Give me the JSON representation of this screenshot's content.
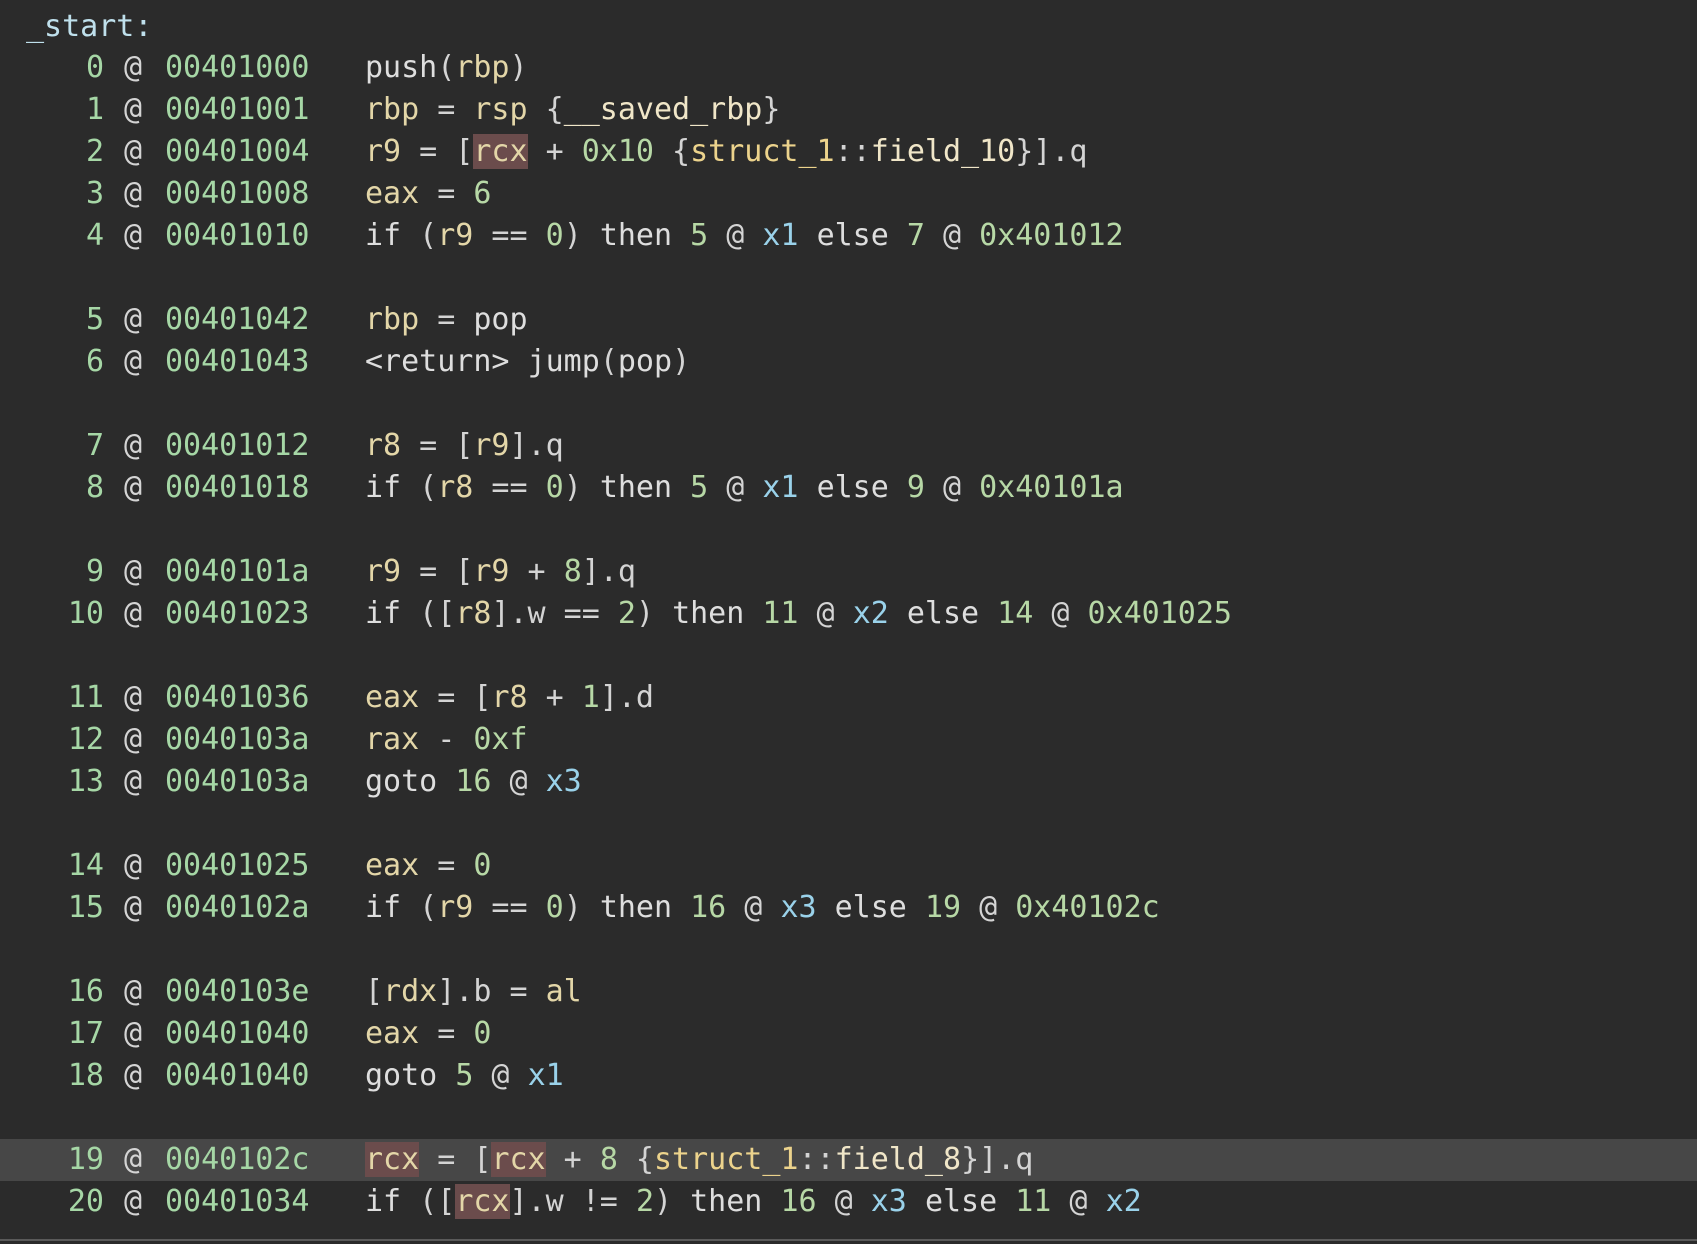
{
  "function_label": "_start:",
  "lines": [
    {
      "index": "0",
      "addr": "00401000",
      "tokens": [
        {
          "t": "push",
          "c": "kw"
        },
        {
          "t": "(",
          "c": "op"
        },
        {
          "t": "rbp",
          "c": "reg"
        },
        {
          "t": ")",
          "c": "op"
        }
      ]
    },
    {
      "index": "1",
      "addr": "00401001",
      "tokens": [
        {
          "t": "rbp",
          "c": "reg"
        },
        {
          "t": " = ",
          "c": "op"
        },
        {
          "t": "rsp",
          "c": "reg"
        },
        {
          "t": " {",
          "c": "op"
        },
        {
          "t": "__saved_rbp",
          "c": "field"
        },
        {
          "t": "}",
          "c": "op"
        }
      ]
    },
    {
      "index": "2",
      "addr": "00401004",
      "tokens": [
        {
          "t": "r9",
          "c": "reg"
        },
        {
          "t": " = [",
          "c": "op"
        },
        {
          "t": "rcx",
          "c": "reg",
          "hl": true
        },
        {
          "t": " + ",
          "c": "op"
        },
        {
          "t": "0x10",
          "c": "num"
        },
        {
          "t": " {",
          "c": "op"
        },
        {
          "t": "struct_1",
          "c": "type"
        },
        {
          "t": "::",
          "c": "op"
        },
        {
          "t": "field_10",
          "c": "field"
        },
        {
          "t": "}].q",
          "c": "op"
        }
      ]
    },
    {
      "index": "3",
      "addr": "00401008",
      "tokens": [
        {
          "t": "eax",
          "c": "reg"
        },
        {
          "t": " = ",
          "c": "op"
        },
        {
          "t": "6",
          "c": "num"
        }
      ]
    },
    {
      "index": "4",
      "addr": "00401010",
      "tokens": [
        {
          "t": "if",
          "c": "kw"
        },
        {
          "t": " (",
          "c": "op"
        },
        {
          "t": "r9",
          "c": "reg"
        },
        {
          "t": " == ",
          "c": "op"
        },
        {
          "t": "0",
          "c": "num"
        },
        {
          "t": ") ",
          "c": "op"
        },
        {
          "t": "then",
          "c": "kw"
        },
        {
          "t": " ",
          "c": "op"
        },
        {
          "t": "5",
          "c": "num"
        },
        {
          "t": " @ ",
          "c": "op"
        },
        {
          "t": "x1",
          "c": "lbl"
        },
        {
          "t": " ",
          "c": "op"
        },
        {
          "t": "else",
          "c": "kw"
        },
        {
          "t": " ",
          "c": "op"
        },
        {
          "t": "7",
          "c": "num"
        },
        {
          "t": " @ ",
          "c": "op"
        },
        {
          "t": "0x401012",
          "c": "num"
        }
      ]
    },
    {
      "index": "5",
      "addr": "00401042",
      "tokens": [
        {
          "t": "rbp",
          "c": "reg"
        },
        {
          "t": " = ",
          "c": "op"
        },
        {
          "t": "pop",
          "c": "kw"
        }
      ]
    },
    {
      "index": "6",
      "addr": "00401043",
      "tokens": [
        {
          "t": "<return>",
          "c": "kw"
        },
        {
          "t": " ",
          "c": "op"
        },
        {
          "t": "jump",
          "c": "kw"
        },
        {
          "t": "(",
          "c": "op"
        },
        {
          "t": "pop",
          "c": "kw"
        },
        {
          "t": ")",
          "c": "op"
        }
      ]
    },
    {
      "index": "7",
      "addr": "00401012",
      "tokens": [
        {
          "t": "r8",
          "c": "reg"
        },
        {
          "t": " = [",
          "c": "op"
        },
        {
          "t": "r9",
          "c": "reg"
        },
        {
          "t": "].q",
          "c": "op"
        }
      ]
    },
    {
      "index": "8",
      "addr": "00401018",
      "tokens": [
        {
          "t": "if",
          "c": "kw"
        },
        {
          "t": " (",
          "c": "op"
        },
        {
          "t": "r8",
          "c": "reg"
        },
        {
          "t": " == ",
          "c": "op"
        },
        {
          "t": "0",
          "c": "num"
        },
        {
          "t": ") ",
          "c": "op"
        },
        {
          "t": "then",
          "c": "kw"
        },
        {
          "t": " ",
          "c": "op"
        },
        {
          "t": "5",
          "c": "num"
        },
        {
          "t": " @ ",
          "c": "op"
        },
        {
          "t": "x1",
          "c": "lbl"
        },
        {
          "t": " ",
          "c": "op"
        },
        {
          "t": "else",
          "c": "kw"
        },
        {
          "t": " ",
          "c": "op"
        },
        {
          "t": "9",
          "c": "num"
        },
        {
          "t": " @ ",
          "c": "op"
        },
        {
          "t": "0x40101a",
          "c": "num"
        }
      ]
    },
    {
      "index": "9",
      "addr": "0040101a",
      "tokens": [
        {
          "t": "r9",
          "c": "reg"
        },
        {
          "t": " = [",
          "c": "op"
        },
        {
          "t": "r9",
          "c": "reg"
        },
        {
          "t": " + ",
          "c": "op"
        },
        {
          "t": "8",
          "c": "num"
        },
        {
          "t": "].q",
          "c": "op"
        }
      ]
    },
    {
      "index": "10",
      "addr": "00401023",
      "tokens": [
        {
          "t": "if",
          "c": "kw"
        },
        {
          "t": " ([",
          "c": "op"
        },
        {
          "t": "r8",
          "c": "reg"
        },
        {
          "t": "].w == ",
          "c": "op"
        },
        {
          "t": "2",
          "c": "num"
        },
        {
          "t": ") ",
          "c": "op"
        },
        {
          "t": "then",
          "c": "kw"
        },
        {
          "t": " ",
          "c": "op"
        },
        {
          "t": "11",
          "c": "num"
        },
        {
          "t": " @ ",
          "c": "op"
        },
        {
          "t": "x2",
          "c": "lbl"
        },
        {
          "t": " ",
          "c": "op"
        },
        {
          "t": "else",
          "c": "kw"
        },
        {
          "t": " ",
          "c": "op"
        },
        {
          "t": "14",
          "c": "num"
        },
        {
          "t": " @ ",
          "c": "op"
        },
        {
          "t": "0x401025",
          "c": "num"
        }
      ]
    },
    {
      "index": "11",
      "addr": "00401036",
      "tokens": [
        {
          "t": "eax",
          "c": "reg"
        },
        {
          "t": " = [",
          "c": "op"
        },
        {
          "t": "r8",
          "c": "reg"
        },
        {
          "t": " + ",
          "c": "op"
        },
        {
          "t": "1",
          "c": "num"
        },
        {
          "t": "].d",
          "c": "op"
        }
      ]
    },
    {
      "index": "12",
      "addr": "0040103a",
      "tokens": [
        {
          "t": "rax",
          "c": "reg"
        },
        {
          "t": " - ",
          "c": "op"
        },
        {
          "t": "0xf",
          "c": "num"
        }
      ]
    },
    {
      "index": "13",
      "addr": "0040103a",
      "tokens": [
        {
          "t": "goto",
          "c": "kw"
        },
        {
          "t": " ",
          "c": "op"
        },
        {
          "t": "16",
          "c": "num"
        },
        {
          "t": " @ ",
          "c": "op"
        },
        {
          "t": "x3",
          "c": "lbl"
        }
      ]
    },
    {
      "index": "14",
      "addr": "00401025",
      "tokens": [
        {
          "t": "eax",
          "c": "reg"
        },
        {
          "t": " = ",
          "c": "op"
        },
        {
          "t": "0",
          "c": "num"
        }
      ]
    },
    {
      "index": "15",
      "addr": "0040102a",
      "tokens": [
        {
          "t": "if",
          "c": "kw"
        },
        {
          "t": " (",
          "c": "op"
        },
        {
          "t": "r9",
          "c": "reg"
        },
        {
          "t": " == ",
          "c": "op"
        },
        {
          "t": "0",
          "c": "num"
        },
        {
          "t": ") ",
          "c": "op"
        },
        {
          "t": "then",
          "c": "kw"
        },
        {
          "t": " ",
          "c": "op"
        },
        {
          "t": "16",
          "c": "num"
        },
        {
          "t": " @ ",
          "c": "op"
        },
        {
          "t": "x3",
          "c": "lbl"
        },
        {
          "t": " ",
          "c": "op"
        },
        {
          "t": "else",
          "c": "kw"
        },
        {
          "t": " ",
          "c": "op"
        },
        {
          "t": "19",
          "c": "num"
        },
        {
          "t": " @ ",
          "c": "op"
        },
        {
          "t": "0x40102c",
          "c": "num"
        }
      ]
    },
    {
      "index": "16",
      "addr": "0040103e",
      "tokens": [
        {
          "t": "[",
          "c": "op"
        },
        {
          "t": "rdx",
          "c": "reg"
        },
        {
          "t": "].b = ",
          "c": "op"
        },
        {
          "t": "al",
          "c": "reg"
        }
      ]
    },
    {
      "index": "17",
      "addr": "00401040",
      "tokens": [
        {
          "t": "eax",
          "c": "reg"
        },
        {
          "t": " = ",
          "c": "op"
        },
        {
          "t": "0",
          "c": "num"
        }
      ]
    },
    {
      "index": "18",
      "addr": "00401040",
      "tokens": [
        {
          "t": "goto",
          "c": "kw"
        },
        {
          "t": " ",
          "c": "op"
        },
        {
          "t": "5",
          "c": "num"
        },
        {
          "t": " @ ",
          "c": "op"
        },
        {
          "t": "x1",
          "c": "lbl"
        }
      ]
    },
    {
      "index": "19",
      "addr": "0040102c",
      "selected": true,
      "tokens": [
        {
          "t": "rcx",
          "c": "reg",
          "hl": true
        },
        {
          "t": " = [",
          "c": "op"
        },
        {
          "t": "rcx",
          "c": "reg",
          "hl": true
        },
        {
          "t": " + ",
          "c": "op"
        },
        {
          "t": "8",
          "c": "num"
        },
        {
          "t": " {",
          "c": "op"
        },
        {
          "t": "struct_1",
          "c": "type"
        },
        {
          "t": "::",
          "c": "op"
        },
        {
          "t": "field_8",
          "c": "field"
        },
        {
          "t": "}].q",
          "c": "op"
        }
      ]
    },
    {
      "index": "20",
      "addr": "00401034",
      "tokens": [
        {
          "t": "if",
          "c": "kw"
        },
        {
          "t": " ([",
          "c": "op"
        },
        {
          "t": "rcx",
          "c": "reg",
          "hl": true
        },
        {
          "t": "].w != ",
          "c": "op"
        },
        {
          "t": "2",
          "c": "num"
        },
        {
          "t": ") ",
          "c": "op"
        },
        {
          "t": "then",
          "c": "kw"
        },
        {
          "t": " ",
          "c": "op"
        },
        {
          "t": "16",
          "c": "num"
        },
        {
          "t": " @ ",
          "c": "op"
        },
        {
          "t": "x3",
          "c": "lbl"
        },
        {
          "t": " ",
          "c": "op"
        },
        {
          "t": "else",
          "c": "kw"
        },
        {
          "t": " ",
          "c": "op"
        },
        {
          "t": "11",
          "c": "num"
        },
        {
          "t": " @ ",
          "c": "op"
        },
        {
          "t": "x2",
          "c": "lbl"
        }
      ]
    }
  ],
  "colors": {
    "background": "#2b2b2b",
    "selected_row": "#474747",
    "token_highlight": "#6b4c4c",
    "index_and_address": "#a6d7a6",
    "label": "#9ad2ea"
  }
}
